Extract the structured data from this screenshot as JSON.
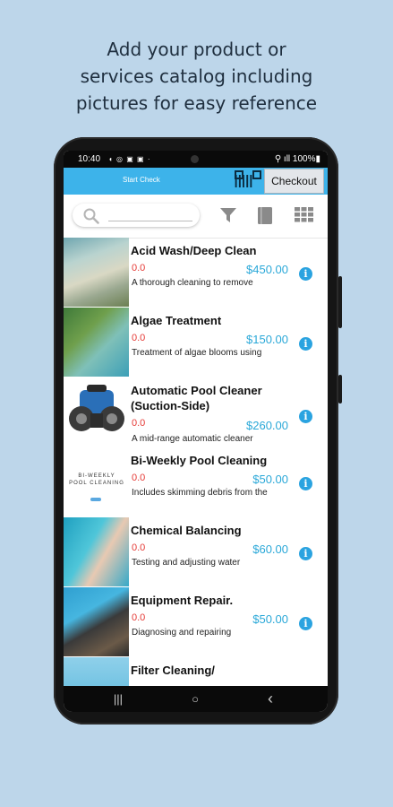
{
  "headline": {
    "line1": "Add your product or",
    "line2": "services catalog including",
    "line3": "pictures for easy reference"
  },
  "status": {
    "time": "10:40",
    "left_icons": "◖ ◎ ▣ ▣ ·",
    "right": "⚲ ıll 100%▮"
  },
  "appbar": {
    "start_check": "Start Check",
    "barcode_glyph": "|||||",
    "checkout": "Checkout"
  },
  "search": {
    "placeholder": ""
  },
  "items": [
    {
      "title": "Acid Wash/Deep Clean",
      "qty": "0.0",
      "price": "$450.00",
      "desc": "A thorough cleaning to remove",
      "info": "i"
    },
    {
      "title": "Algae Treatment",
      "qty": "0.0",
      "price": "$150.00",
      "desc": "Treatment of algae blooms using",
      "info": "i"
    },
    {
      "title": "Automatic Pool Cleaner (Suction-Side)",
      "qty": "0.0",
      "price": "$260.00",
      "desc": "A mid-range automatic cleaner",
      "info": "i"
    },
    {
      "title": "Bi-Weekly Pool Cleaning",
      "qty": "0.0",
      "price": "$50.00",
      "desc": "Includes skimming debris from the",
      "info": "i",
      "thumb_text": "BI-WEEKLY POOL CLEANING"
    },
    {
      "title": "Chemical Balancing",
      "qty": "0.0",
      "price": "$60.00",
      "desc": "Testing and adjusting water",
      "info": "i"
    },
    {
      "title": "Equipment Repair.",
      "qty": "0.0",
      "price": "$50.00",
      "desc": "Diagnosing and repairing",
      "info": "i"
    },
    {
      "title": "Filter Cleaning/",
      "qty": "",
      "price": "",
      "desc": "",
      "info": ""
    }
  ],
  "navbar": {
    "recents": "|||",
    "home": "○",
    "back": "‹"
  },
  "colors": {
    "accent": "#3db3ea",
    "price": "#2aa8d8",
    "qty": "#e53935",
    "background": "#bdd6ea"
  }
}
